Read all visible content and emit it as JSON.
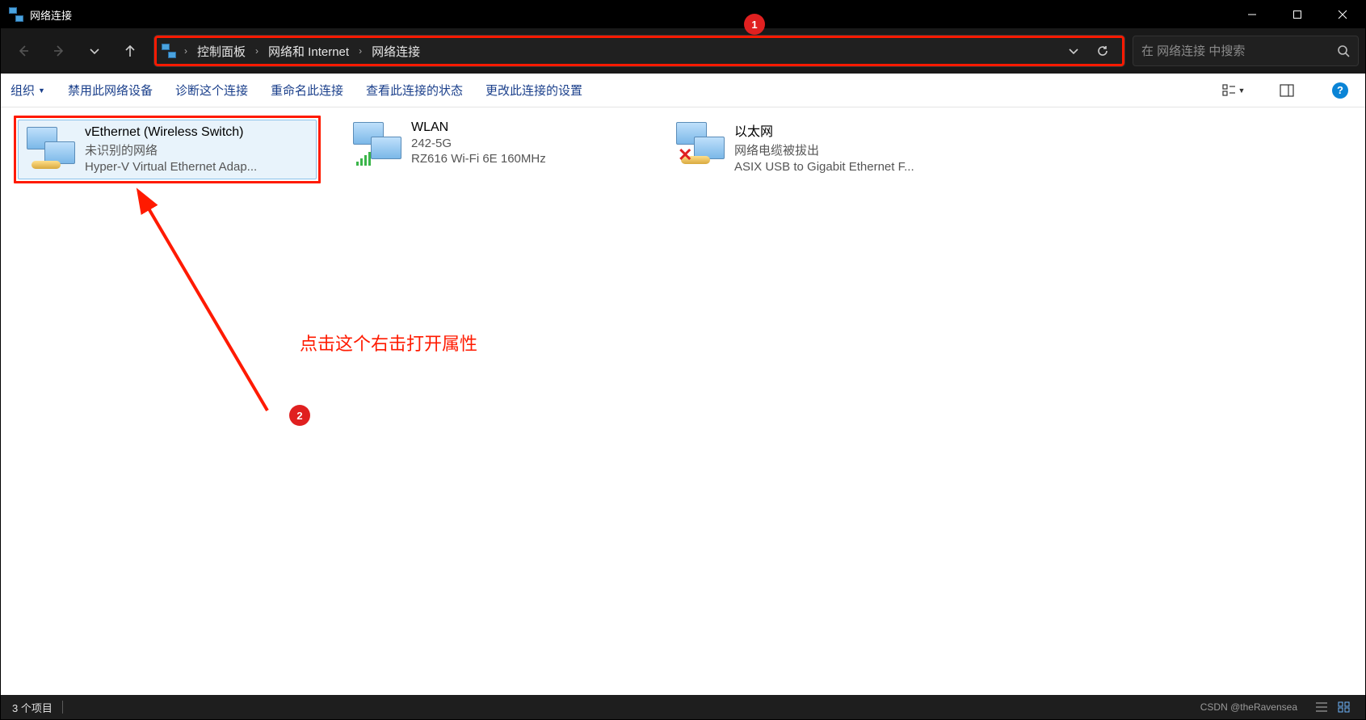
{
  "titlebar": {
    "title": "网络连接"
  },
  "breadcrumbs": {
    "p0": "控制面板",
    "p1": "网络和 Internet",
    "p2": "网络连接"
  },
  "search": {
    "placeholder": "在 网络连接 中搜索"
  },
  "toolbar": {
    "organize": "组织",
    "disable": "禁用此网络设备",
    "diagnose": "诊断这个连接",
    "rename": "重命名此连接",
    "status": "查看此连接的状态",
    "change": "更改此连接的设置"
  },
  "items": [
    {
      "title": "vEthernet (Wireless Switch)",
      "status": "未识别的网络",
      "detail": "Hyper-V Virtual Ethernet Adap..."
    },
    {
      "title": "WLAN",
      "status": "242-5G",
      "detail": "RZ616 Wi-Fi 6E 160MHz"
    },
    {
      "title": "以太网",
      "status": "网络电缆被拔出",
      "detail": "ASIX USB to Gigabit Ethernet F..."
    }
  ],
  "annotations": {
    "text": "点击这个右击打开属性",
    "badge1": "1",
    "badge2": "2"
  },
  "statusbar": {
    "count": "3 个项目",
    "watermark": "CSDN @theRavensea"
  }
}
